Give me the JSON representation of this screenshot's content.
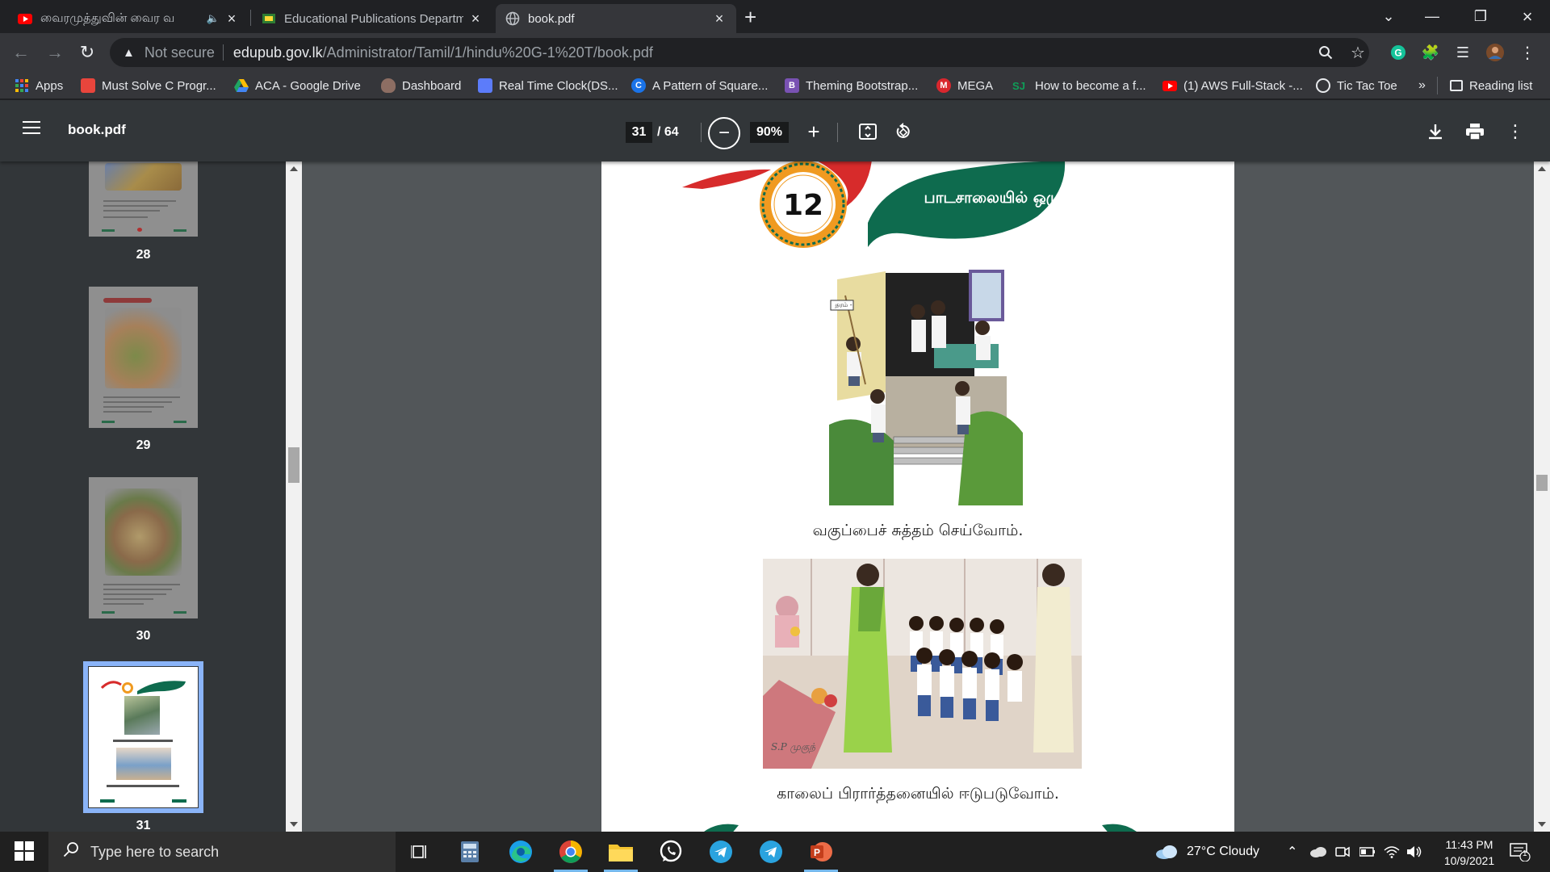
{
  "browser": {
    "tabs": [
      {
        "title": "வைரமுத்துவின் வைர வ",
        "audio": true,
        "active": false
      },
      {
        "title": "Educational Publications Departm",
        "active": false
      },
      {
        "title": "book.pdf",
        "active": true
      }
    ],
    "new_tab_label": "+",
    "address": {
      "security_label": "Not secure",
      "host": "edupub.gov.lk",
      "path": "/Administrator/Tamil/1/hindu%20G-1%20T/book.pdf"
    },
    "bookmarks": [
      {
        "label": "Apps",
        "icon": "apps-grid-icon",
        "color": "#4285f4"
      },
      {
        "label": "Must Solve C Progr...",
        "icon": "bookmark-favicon",
        "color": "#e8453c"
      },
      {
        "label": "ACA - Google Drive",
        "icon": "google-drive-icon",
        "color": "#1fa463"
      },
      {
        "label": "Dashboard",
        "icon": "dashboard-icon",
        "color": "#8d6e63"
      },
      {
        "label": "Real Time Clock(DS...",
        "icon": "image-favicon",
        "color": "#5c7cfa"
      },
      {
        "label": "A Pattern of Square...",
        "icon": "c-favicon",
        "color": "#1a73e8"
      },
      {
        "label": "Theming Bootstrap...",
        "icon": "bootstrap-icon",
        "color": "#7952b3"
      },
      {
        "label": "MEGA",
        "icon": "mega-icon",
        "color": "#d9272e"
      },
      {
        "label": "How to become a f...",
        "icon": "sj-favicon",
        "color": "#0f9d58"
      },
      {
        "label": "(1) AWS Full-Stack -...",
        "icon": "youtube-icon",
        "color": "#ff0000"
      },
      {
        "label": "Tic Tac Toe",
        "icon": "codepen-icon",
        "color": "#333333"
      }
    ],
    "overflow_label": "»",
    "reading_list_label": "Reading list"
  },
  "pdf": {
    "title": "book.pdf",
    "current_page": "31",
    "page_count": "/ 64",
    "zoom": "90%",
    "thumbnails": [
      {
        "label": "28"
      },
      {
        "label": "29"
      },
      {
        "label": "30"
      },
      {
        "label": "31",
        "selected": true
      }
    ],
    "page": {
      "lesson_number": "12",
      "lesson_title": "பாடசாலையில் ஒழுக்கம்",
      "board_sign": "தரம் -",
      "caption_1": "வகுப்பைச் சுத்தம் செய்வோம்.",
      "caption_2": "காலைப் பிரார்த்தனையில் ஈடுபடுவோம்.",
      "artist_signature": "S.P முகுந்"
    }
  },
  "taskbar": {
    "search_placeholder": "Type here to search",
    "weather": "27°C  Cloudy",
    "time": "11:43 PM",
    "date": "10/9/2021",
    "notification_count": "1"
  },
  "colors": {
    "green": "#0e6b4e",
    "red": "#d72b2b",
    "orange": "#f09a20",
    "accent": "#8ab4f8"
  }
}
